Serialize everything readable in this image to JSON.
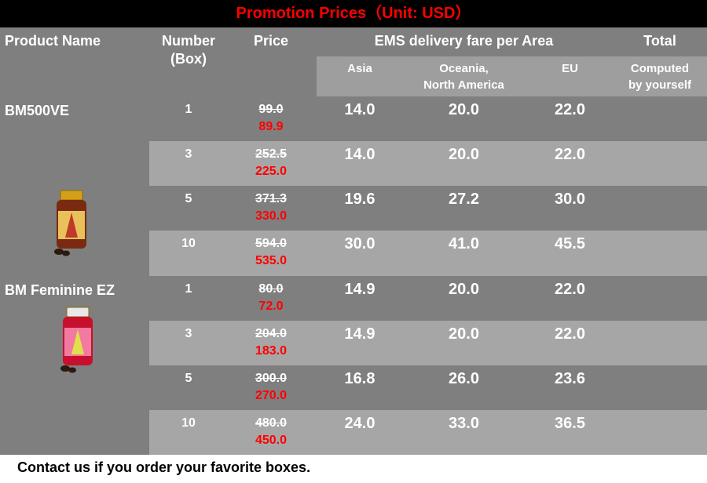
{
  "title": "Promotion Prices（Unit: USD）",
  "headers": {
    "product_name": "Product Name",
    "number": "Number",
    "number_unit": "(Box)",
    "price": "Price",
    "ems": "EMS delivery fare per Area",
    "total": "Total"
  },
  "areas": {
    "asia": "Asia",
    "oceania_line1": "Oceania,",
    "oceania_line2": "North America",
    "eu": "EU",
    "total_line1": "Computed",
    "total_line2": "by yourself"
  },
  "products": [
    {
      "name": "BM500VE",
      "image": "supplement-bottle-gold-icon",
      "rows": [
        {
          "boxes": "1",
          "old_price": "99.0",
          "new_price": "89.9",
          "asia": "14.0",
          "oceania": "20.0",
          "eu": "22.0"
        },
        {
          "boxes": "3",
          "old_price": "252.5",
          "new_price": "225.0",
          "asia": "14.0",
          "oceania": "20.0",
          "eu": "22.0"
        },
        {
          "boxes": "5",
          "old_price": "371.3",
          "new_price": "330.0",
          "asia": "19.6",
          "oceania": "27.2",
          "eu": "30.0"
        },
        {
          "boxes": "10",
          "old_price": "594.0",
          "new_price": "535.0",
          "asia": "30.0",
          "oceania": "41.0",
          "eu": "45.5"
        }
      ]
    },
    {
      "name": "BM Feminine EZ",
      "image": "supplement-bottle-pink-icon",
      "rows": [
        {
          "boxes": "1",
          "old_price": "80.0",
          "new_price": "72.0",
          "asia": "14.9",
          "oceania": "20.0",
          "eu": "22.0"
        },
        {
          "boxes": "3",
          "old_price": "204.0",
          "new_price": "183.0",
          "asia": "14.9",
          "oceania": "20.0",
          "eu": "22.0"
        },
        {
          "boxes": "5",
          "old_price": "300.0",
          "new_price": "270.0",
          "asia": "16.8",
          "oceania": "26.0",
          "eu": "23.6"
        },
        {
          "boxes": "10",
          "old_price": "480.0",
          "new_price": "450.0",
          "asia": "24.0",
          "oceania": "33.0",
          "eu": "36.5"
        }
      ]
    }
  ],
  "footer": "Contact us if you order your favorite boxes.",
  "colors": {
    "title_bg": "#000000",
    "title_text": "#ff0000",
    "dark_gray": "#7f7f7f",
    "light_gray": "#a6a6a6",
    "area_bar": "#9e9e9e",
    "sale_price": "#ff0000"
  }
}
